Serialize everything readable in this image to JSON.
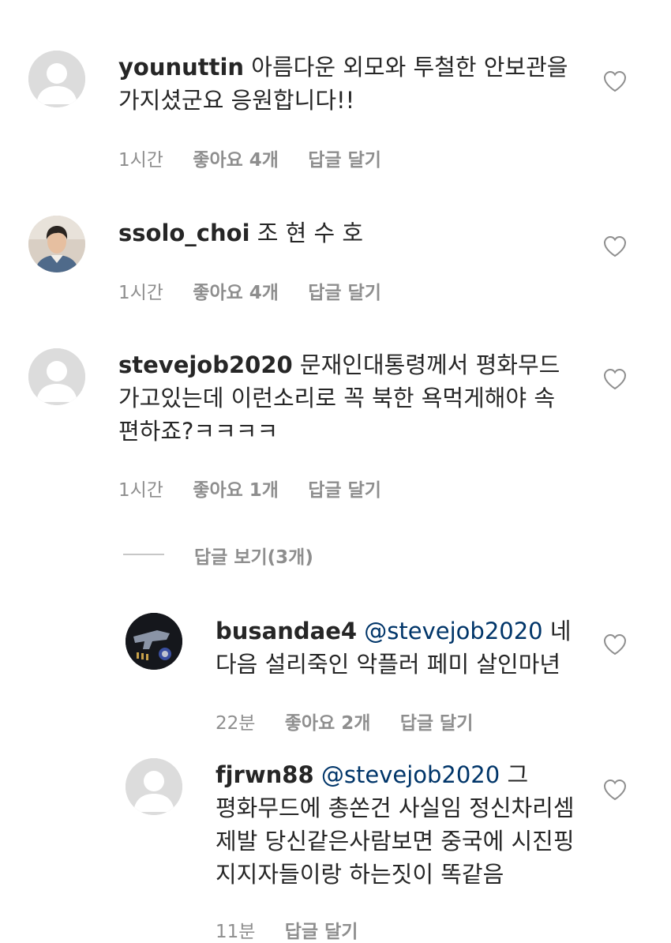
{
  "comments": [
    {
      "username": "younuttin",
      "text": "아름다운 외모와 투철한 안보관을 가지셨군요 응원합니다!!",
      "time": "1시간",
      "likes": "좋아요 4개",
      "reply": "답글 달기",
      "avatar": "default-avatar"
    },
    {
      "username": "ssolo_choi",
      "text": "조 현 수 호",
      "time": "1시간",
      "likes": "좋아요 4개",
      "reply": "답글 달기",
      "avatar": "photo-avatar"
    },
    {
      "username": "stevejob2020",
      "text": "문재인대통령께서 평화무드 가고있는데 이런소리로 꼭 북한 욕먹게해야 속 편하죠?ㅋㅋㅋㅋ",
      "time": "1시간",
      "likes": "좋아요 1개",
      "reply": "답글 달기",
      "avatar": "default-avatar"
    }
  ],
  "view_replies": "답글 보기(3개)",
  "replies": [
    {
      "username": "busandae4",
      "mention": "@stevejob2020",
      "text": "네 다음 설리죽인 악플러 페미 살인마년",
      "time": "22분",
      "likes": "좋아요 2개",
      "reply": "답글 달기",
      "avatar": "photo-avatar"
    },
    {
      "username": "fjrwn88",
      "mention": "@stevejob2020",
      "text": "그 평화무드에 총쏜건 사실임 정신차리셈 제발 당신같은사람보면 중국에 시진핑 지지자들이랑 하는짓이 똑같음",
      "time": "11분",
      "reply": "답글 달기",
      "avatar": "default-avatar"
    }
  ],
  "icons": {
    "like": "heart-outline-icon"
  },
  "colors": {
    "text": "#262626",
    "meta": "#8e8e8e",
    "mention": "#003569",
    "avatar_bg": "#dcdcdc"
  }
}
